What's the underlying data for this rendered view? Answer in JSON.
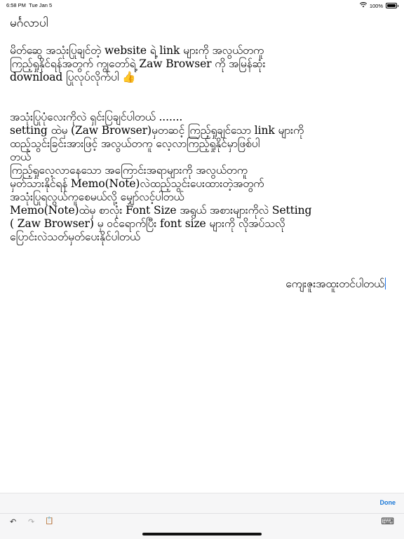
{
  "status_bar": {
    "time": "6:58 PM",
    "date": "Tue Jan 5",
    "wifi_icon": "wifi-icon",
    "battery_percent": "100%",
    "battery_icon": "battery-icon"
  },
  "document": {
    "greeting": "မင်္ဂလာပါ",
    "paragraph1": [
      "မိတ်ဆွေ အသုံးပြုချင်တဲ့ website ရဲ့ link များကို အလွယ်တကူ",
      "ကြည့်ရှုနိုင်ရန်အတွက် ကျွတော်ရဲ့ Zaw Browser ကို အမြန်ဆုံး",
      "download ပြုလုပ်လိုက်ပါ 👍"
    ],
    "paragraph2": [
      "အသုံးပြုပုံလေးကိုလဲ ရှင်းပြချင်ပါတယ် .......",
      "setting ထဲမှ (Zaw Browser)မှတဆင့် ကြည့်ရှုချင်သော link များကို",
      "ထည့်သွင်းခြင်းအားဖြင့် အလွယ်တကူ လေ့လာကြည့်ရှုနိုင်မှာဖြစ်ပါ",
      "တယ်",
      "ကြည့်ရှုလေ့လာနေသော အကြောင်းအရာများကို အလွယ်တကူ",
      "မှတ်သားနိုင်ရန် Memo(Note)လဲထည့်သွင်းပေးထားတဲ့အတွက်",
      "အသုံးပြုရလွယ်ကူစေမယ်လို့ မျှော်လင့်ပါတယ်",
      "Memo(Note)ထဲမှ စာလုံး Font Size အရွယ် အစားများကိုလဲ Setting",
      "( Zaw Browser)  မှ ဝင်ရောက်ပြီး font size များကို လိုအပ်သလို",
      "ပြောင်းလဲသတ်မှတ်ပေးနိုင်ပါတယ်"
    ],
    "signature": "ကျေးဇူးအထူးတင်ပါတယ်"
  },
  "keyboard_bar": {
    "done_label": "Done",
    "undo_icon": "undo-icon",
    "redo_icon": "redo-icon",
    "paste_icon": "paste-icon",
    "keyboard_icon": "keyboard-icon",
    "undo_glyph": "↶",
    "redo_glyph": "↷",
    "paste_glyph": "📋",
    "keyboard_glyph": "⌨"
  }
}
